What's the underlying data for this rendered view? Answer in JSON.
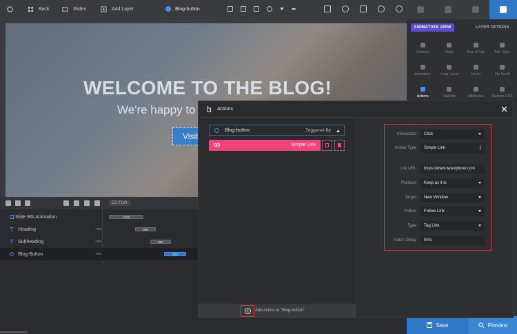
{
  "toolbar": {
    "back": "Back",
    "slides": "Slides",
    "add_layer": "Add Layer",
    "layer_title": "Blog-button"
  },
  "right_panel": {
    "animation_view": "ANIMATION VIEW",
    "layer_options": "LAYER OPTIONS",
    "options": [
      "Colorize",
      "Style",
      "Size & Pos",
      "Adv. Style",
      "Animation",
      "Loop Layer",
      "Hover",
      "On Scroll",
      "Actions",
      "Visibility",
      "Attributes",
      "Custom CSS"
    ],
    "active_option": "Actions",
    "save": "Save",
    "preview": "Preview"
  },
  "canvas": {
    "headline": "WELCOME TO THE BLOG!",
    "subline": "We're happy to",
    "button": "Visit"
  },
  "timeline": {
    "editor": "EDITOR",
    "rows": [
      {
        "label": "Slide BG Animation",
        "value": "1000"
      },
      {
        "label": "Heading",
        "ms": "+ms",
        "value": "900"
      },
      {
        "label": "Subheading",
        "ms": "+ms",
        "value": "900"
      },
      {
        "label": "Blog-Button",
        "ms": "+ms",
        "value": "500"
      }
    ]
  },
  "dialog": {
    "title": "Actions",
    "trigger_name": "Blog-button",
    "triggered_by": "Triggered By",
    "action_label": "Simple Link",
    "add_action": "Add Action to \"Blog-button\"",
    "props": [
      {
        "label": "Interaction",
        "value": "Click",
        "ctl": "caret"
      },
      {
        "label": "Action Type",
        "value": "Simple Link",
        "ctl": "dots"
      },
      {
        "label": "Link URL",
        "value": "https://www.wpexplorer.com",
        "ctl": ""
      },
      {
        "label": "Protocol",
        "value": "Keep as it is",
        "ctl": "caret"
      },
      {
        "label": "Target",
        "value": "New Window",
        "ctl": "caret"
      },
      {
        "label": "Follow",
        "value": "Follow Link",
        "ctl": "caret"
      },
      {
        "label": "Type",
        "value": "Tag Link",
        "ctl": "caret"
      },
      {
        "label": "Action Delay",
        "value": "0ms",
        "ctl": ""
      }
    ]
  },
  "colors": {
    "accent": "#2e78c7",
    "pink": "#f0447a",
    "highlight": "#e0302a",
    "purple": "#5a4bd1"
  }
}
